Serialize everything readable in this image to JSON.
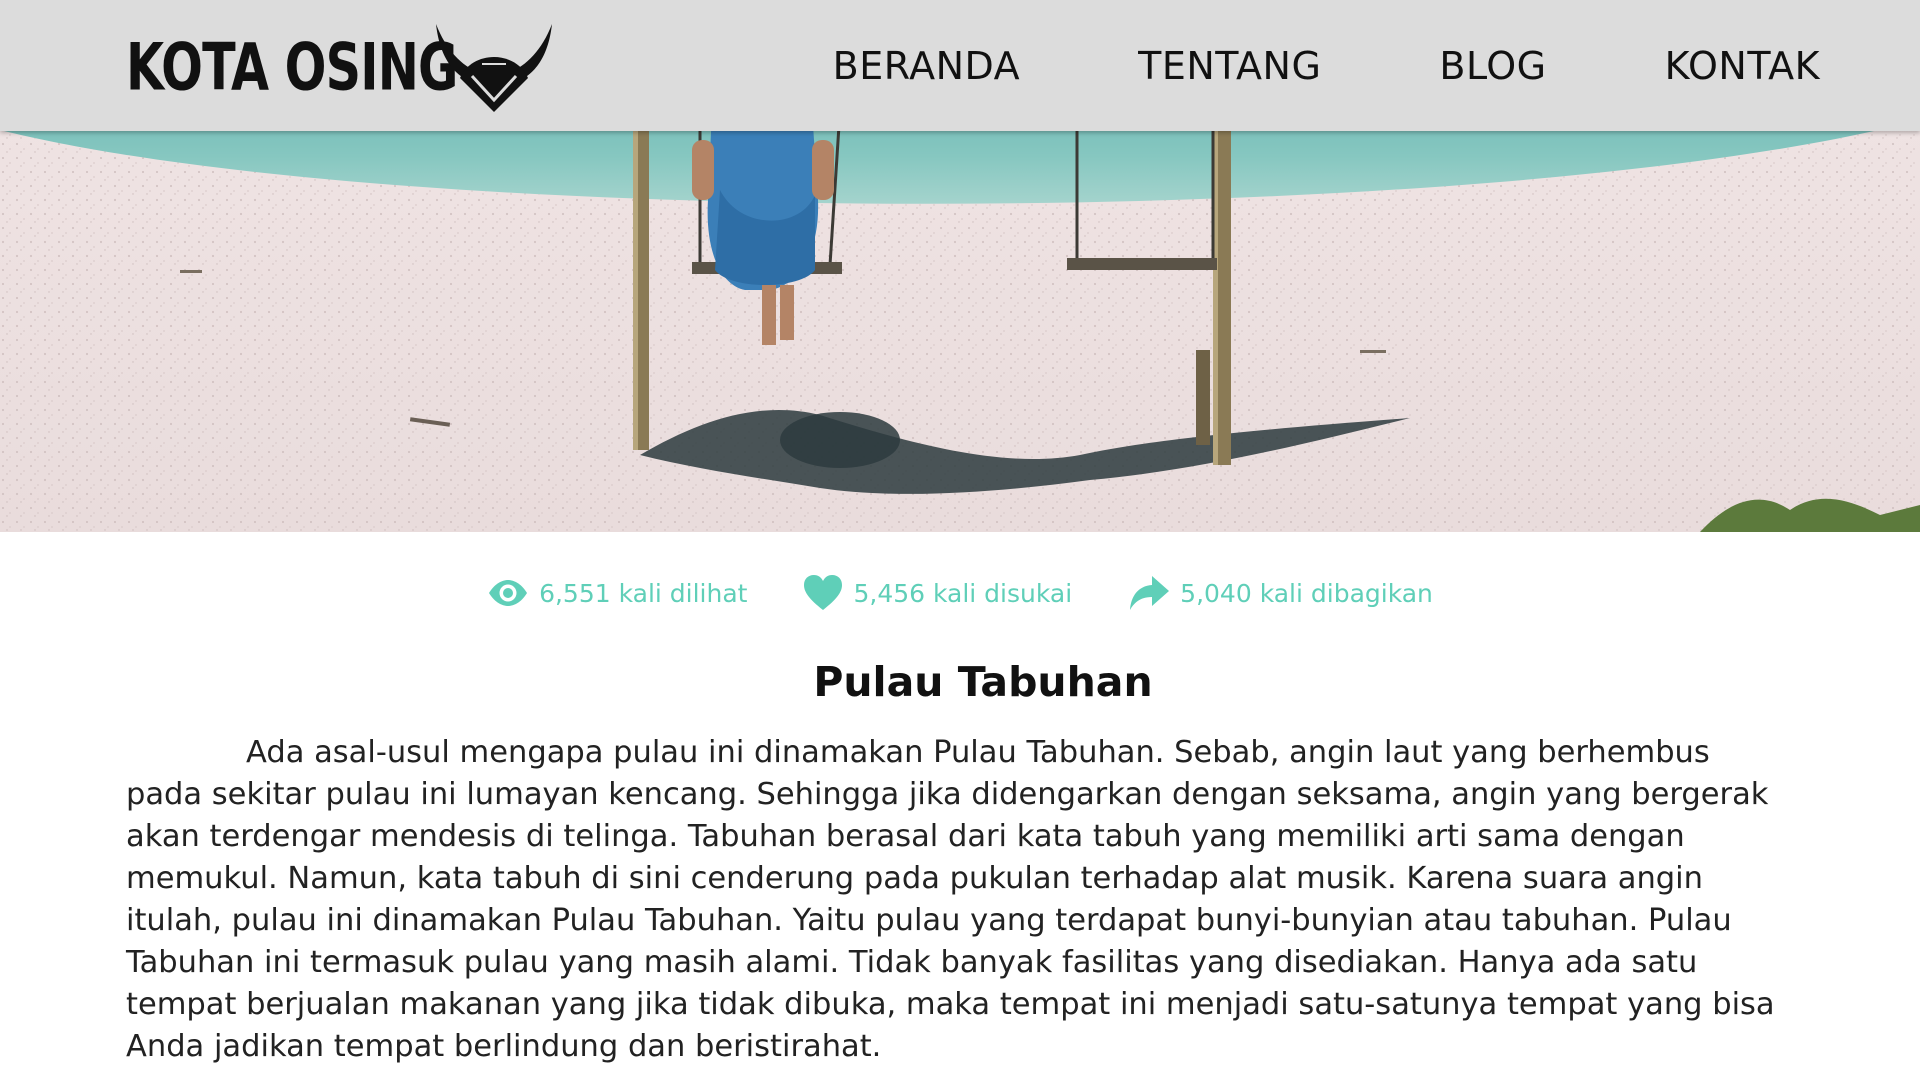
{
  "header": {
    "logo_text": "KOTA OSING",
    "nav": [
      {
        "label": "BERANDA"
      },
      {
        "label": "TENTANG"
      },
      {
        "label": "BLOG"
      },
      {
        "label": "KONTAK"
      }
    ]
  },
  "hero": {
    "icon": "beach-swing-photo"
  },
  "stats": {
    "views": {
      "icon": "eye-icon",
      "text": "6,551 kali dilihat"
    },
    "likes": {
      "icon": "heart-icon",
      "text": "5,456 kali disukai"
    },
    "shares": {
      "icon": "share-arrow-icon",
      "text": "5,040 kali dibagikan"
    }
  },
  "article": {
    "title": "Pulau Tabuhan",
    "body": "Ada asal-usul mengapa pulau ini dinamakan Pulau Tabuhan. Sebab, angin laut yang berhembus pada sekitar pulau ini lumayan kencang. Sehingga jika didengarkan dengan seksama, angin yang bergerak akan terdengar mendesis di telinga. Tabuhan berasal dari kata tabuh yang memiliki arti sama dengan memukul. Namun, kata tabuh di sini cenderung pada pukulan terhadap alat musik. Karena suara angin itulah, pulau ini dinamakan Pulau Tabuhan. Yaitu pulau yang terdapat bunyi-bunyian atau tabuhan. Pulau Tabuhan ini termasuk pulau yang masih alami. Tidak banyak fasilitas yang disediakan. Hanya ada satu tempat berjualan makanan yang jika tidak dibuka, maka tempat ini menjadi satu-satunya tempat yang bisa Anda jadikan tempat berlindung dan beristirahat."
  },
  "colors": {
    "accent": "#5fcfb8",
    "header_bg": "#dcdcdc",
    "text": "#111111"
  }
}
